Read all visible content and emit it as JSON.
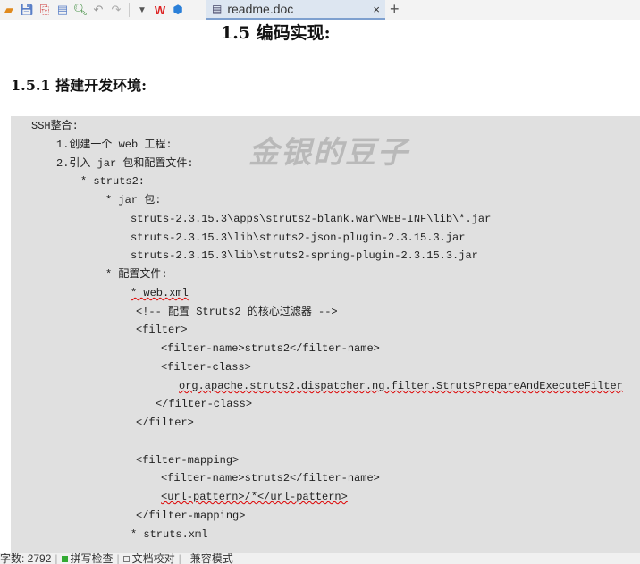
{
  "toolbar": {
    "icons": [
      "open-folder-icon",
      "save-icon",
      "export-pdf-icon",
      "print-icon",
      "print-preview-icon",
      "undo-icon",
      "redo-icon",
      "dropdown-icon",
      "wps-logo-icon",
      "cube-icon"
    ]
  },
  "tab": {
    "title": "readme.doc",
    "close": "×",
    "new_tab": "+"
  },
  "heading1": "1.5  编码实现:",
  "heading2": "1.5.1  搭建开发环境:",
  "watermark": "金银的豆子",
  "code": {
    "lines": [
      "SSH整合:",
      "1.创建一个 web 工程:",
      "2.引入 jar 包和配置文件:",
      "* struts2:",
      "* jar 包:",
      "struts-2.3.15.3\\apps\\struts2-blank.war\\WEB-INF\\lib\\*.jar",
      "struts-2.3.15.3\\lib\\struts2-json-plugin-2.3.15.3.jar",
      "struts-2.3.15.3\\lib\\struts2-spring-plugin-2.3.15.3.jar",
      "* 配置文件:",
      "* web.xml",
      "<!-- 配置 Struts2 的核心过滤器 -->",
      "<filter>",
      "<filter-name>struts2</filter-name>",
      "<filter-class>",
      "org.apache.struts2.dispatcher.ng.filter.StrutsPrepareAndExecuteFilter",
      "</filter-class>",
      "</filter>",
      "<filter-mapping>",
      "<filter-name>struts2</filter-name>",
      "<url-pattern>/*</url-pattern>",
      "</filter-mapping>",
      "* struts.xml"
    ]
  },
  "status": {
    "word_count": "字数: 2792",
    "spell_check": "拼写检查",
    "doc_proof": "文档校对",
    "compat_mode": "兼容模式"
  }
}
